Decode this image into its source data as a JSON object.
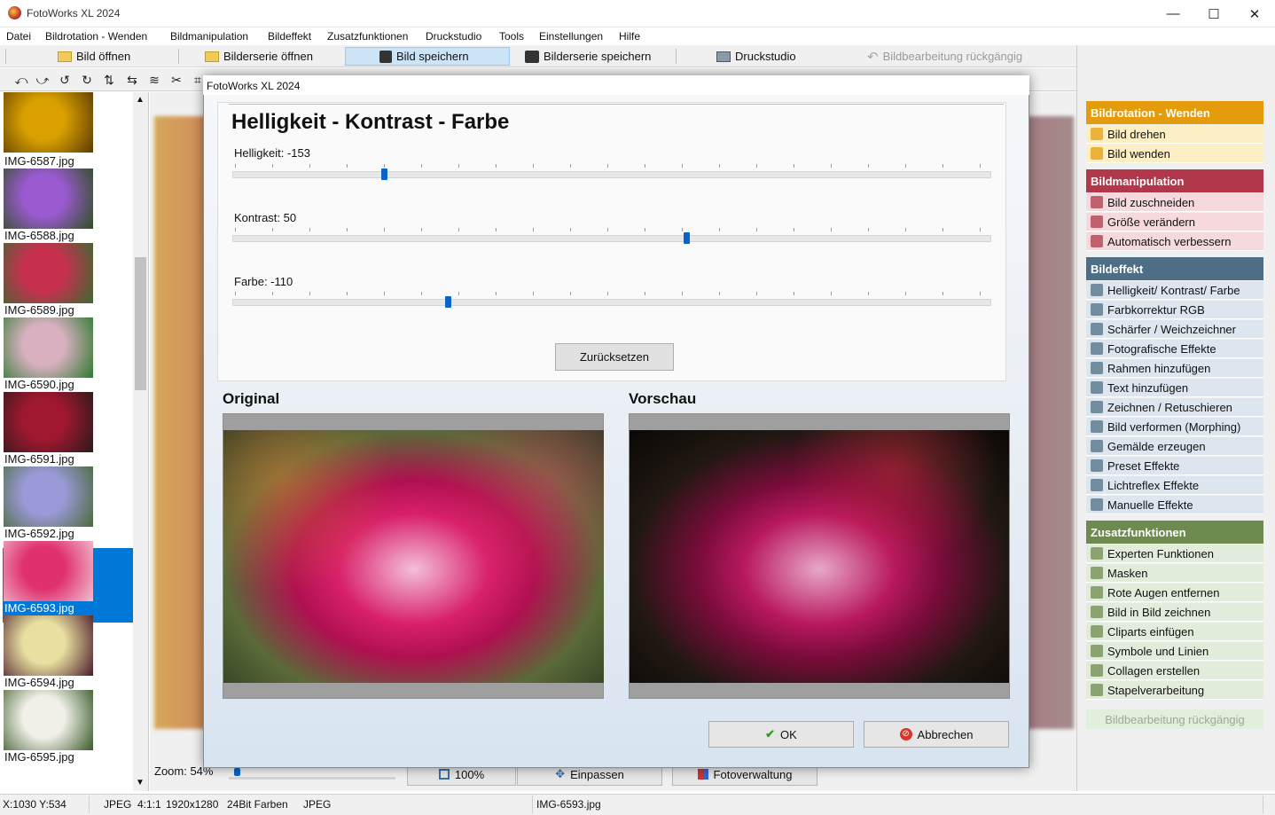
{
  "app": {
    "title": "FotoWorks XL 2024",
    "window_controls": [
      "—",
      "☐",
      "✕"
    ]
  },
  "menu": [
    "Datei",
    "Bildrotation - Wenden",
    "Bildmanipulation",
    "Bildeffekt",
    "Zusatzfunktionen",
    "Druckstudio",
    "Tools",
    "Einstellungen",
    "Hilfe"
  ],
  "toolbar": {
    "open": "Bild öffnen",
    "open_series": "Bilderserie öffnen",
    "save": "Bild speichern",
    "save_series": "Bilderserie speichern",
    "print": "Druckstudio",
    "undo": "Bildbearbeitung rückgängig"
  },
  "thumbnails": [
    {
      "name": "IMG-6587.jpg",
      "colors": [
        "#d9a000",
        "#5a3a00"
      ]
    },
    {
      "name": "IMG-6588.jpg",
      "colors": [
        "#9a5ad0",
        "#2e5020"
      ]
    },
    {
      "name": "IMG-6589.jpg",
      "colors": [
        "#c83050",
        "#3a6a30"
      ]
    },
    {
      "name": "IMG-6590.jpg",
      "colors": [
        "#d8b0c0",
        "#2e7a30"
      ]
    },
    {
      "name": "IMG-6591.jpg",
      "colors": [
        "#a01830",
        "#2a1a1a"
      ]
    },
    {
      "name": "IMG-6592.jpg",
      "colors": [
        "#9a9ad8",
        "#4a6a3a"
      ]
    },
    {
      "name": "IMG-6593.jpg",
      "colors": [
        "#e03070",
        "#f0c0d0"
      ],
      "selected": true
    },
    {
      "name": "IMG-6594.jpg",
      "colors": [
        "#e8e0a0",
        "#4a1a2a"
      ]
    },
    {
      "name": "IMG-6595.jpg",
      "colors": [
        "#f0f0e8",
        "#3a5a2a"
      ]
    }
  ],
  "viewer": {
    "zoom_label": "Zoom: 54%",
    "zoom_percent": 54,
    "btn_100": "100%",
    "btn_fit": "Einpassen",
    "btn_manage": "Fotoverwaltung"
  },
  "dialog": {
    "title": "FotoWorks XL 2024",
    "heading": "Helligkeit - Kontrast - Farbe",
    "sliders": [
      {
        "label": "Helligkeit: -153",
        "value": -153,
        "min": -255,
        "max": 255
      },
      {
        "label": "Kontrast: 50",
        "value": 50,
        "min": -255,
        "max": 255
      },
      {
        "label": "Farbe: -110",
        "value": -110,
        "min": -255,
        "max": 255
      }
    ],
    "reset": "Zurücksetzen",
    "original": "Original",
    "preview": "Vorschau",
    "ok": "OK",
    "cancel": "Abbrechen"
  },
  "sections": [
    {
      "title": "Bildrotation - Wenden",
      "head_color": "#e59c0c",
      "item_bg": "#fdefc4",
      "items": [
        {
          "label": "Bild drehen",
          "icon": "rotate-image-icon"
        },
        {
          "label": "Bild wenden",
          "icon": "flip-image-icon"
        }
      ]
    },
    {
      "title": "Bildmanipulation",
      "head_color": "#b0384a",
      "item_bg": "#f5d9dc",
      "items": [
        {
          "label": "Bild zuschneiden",
          "icon": "scissors-icon"
        },
        {
          "label": "Größe verändern",
          "icon": "resize-icon"
        },
        {
          "label": "Automatisch verbessern",
          "icon": "magic-wand-icon"
        }
      ]
    },
    {
      "title": "Bildeffekt",
      "head_color": "#4e6e86",
      "item_bg": "#dde6ee",
      "items": [
        {
          "label": "Helligkeit/ Kontrast/ Farbe",
          "icon": "brightness-bars-icon"
        },
        {
          "label": "Farbkorrektur RGB",
          "icon": "rgb-icon"
        },
        {
          "label": "Schärfer / Weichzeichner",
          "icon": "sharpen-icon"
        },
        {
          "label": "Fotografische Effekte",
          "icon": "camera-icon"
        },
        {
          "label": "Rahmen hinzufügen",
          "icon": "frame-icon"
        },
        {
          "label": "Text hinzufügen",
          "icon": "text-icon"
        },
        {
          "label": "Zeichnen / Retuschieren",
          "icon": "pencil-icon"
        },
        {
          "label": "Bild verformen (Morphing)",
          "icon": "morph-icon"
        },
        {
          "label": "Gemälde erzeugen",
          "icon": "paint-icon"
        },
        {
          "label": "Preset Effekte",
          "icon": "preset-icon"
        },
        {
          "label": "Lichtreflex Effekte",
          "icon": "light-icon"
        },
        {
          "label": "Manuelle Effekte",
          "icon": "manual-effects-icon"
        }
      ]
    },
    {
      "title": "Zusatzfunktionen",
      "head_color": "#6e8a4e",
      "item_bg": "#e2ecdb",
      "items": [
        {
          "label": "Experten Funktionen",
          "icon": "expert-e-icon"
        },
        {
          "label": "Masken",
          "icon": "mask-icon"
        },
        {
          "label": "Rote Augen entfernen",
          "icon": "red-eye-icon"
        },
        {
          "label": "Bild in Bild zeichnen",
          "icon": "picture-in-picture-icon"
        },
        {
          "label": "Cliparts einfügen",
          "icon": "clipart-icon"
        },
        {
          "label": "Symbole und Linien",
          "icon": "symbols-icon"
        },
        {
          "label": "Collagen erstellen",
          "icon": "star-icon"
        },
        {
          "label": "Stapelverarbeitung",
          "icon": "batch-icon"
        }
      ]
    }
  ],
  "right_undo": "Bildbearbeitung rückgängig",
  "status": {
    "coords": "X:1030 Y:534",
    "format": "JPEG  4:1:1",
    "size": "1920x1280",
    "depth": "24Bit Farben",
    "type": "JPEG",
    "file": "IMG-6593.jpg"
  }
}
